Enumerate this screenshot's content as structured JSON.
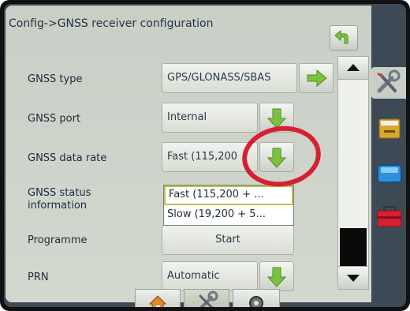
{
  "title": "Config->GNSS receiver configuration",
  "rows": [
    {
      "label": "GNSS type",
      "value": "GPS/GLONASS/SBAS"
    },
    {
      "label": "GNSS port",
      "value": "Internal"
    },
    {
      "label": "GNSS data rate",
      "value": "Fast (115,200"
    },
    {
      "label": "GNSS status information",
      "value": ""
    },
    {
      "label": "Programme",
      "value": "Start"
    },
    {
      "label": "PRN",
      "value": "Automatic"
    }
  ],
  "dropdown": {
    "options": [
      "Fast (115,200 + ...",
      "Slow (19,200 + 5..."
    ],
    "selected_index": 0
  },
  "icons": {
    "back": "back-arrow-icon",
    "next": "right-arrow-icon",
    "select": "down-arrow-icon",
    "scroll_up": "triangle-up-icon",
    "scroll_down": "triangle-down-icon",
    "side": [
      "tools-icon",
      "console-icon",
      "display-icon",
      "toolbox-icon"
    ],
    "bottom": [
      "home-icon",
      "tools-icon",
      "gnss-antenna-icon"
    ]
  },
  "colors": {
    "accent_green": "#7cc242",
    "highlight": "#d62032",
    "selection_border": "#b9c34a"
  }
}
